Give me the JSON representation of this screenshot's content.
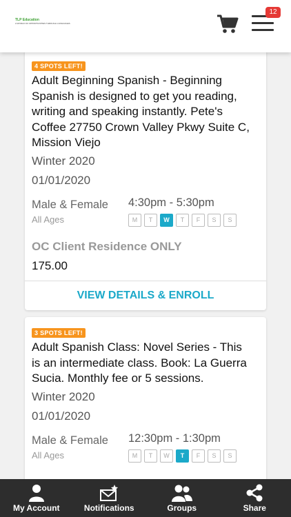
{
  "header": {
    "logo_line1": "TLP Education",
    "logo_line2": "A WORLD OF OPPORTUNITIES THROUGH LANGUAGES",
    "cart_icon": "cart-icon",
    "menu_icon": "hamburger-menu-icon",
    "notification_count": "12"
  },
  "courses": [
    {
      "spots": "4 SPOTS LEFT!",
      "title": "Adult Beginning Spanish - Beginning Spanish is designed to get you reading, writing and speaking instantly. Pete's Coffee 27750 Crown Valley Pkwy Suite C, Mission Viejo",
      "season": "Winter 2020",
      "date": "01/01/2020",
      "gender": "Male & Female",
      "ages": "All Ages",
      "time": "4:30pm - 5:30pm",
      "days": [
        "M",
        "T",
        "W",
        "T",
        "F",
        "S",
        "S"
      ],
      "active_day": 2,
      "location": "OC Client Residence ONLY",
      "price": "175.00",
      "enroll_label": "VIEW DETAILS & ENROLL"
    },
    {
      "spots": "3 SPOTS LEFT!",
      "title": "Adult Spanish Class: Novel Series - This is an intermediate class. Book: La Guerra Sucia. Monthly fee or 5 sessions.",
      "season": "Winter 2020",
      "date": "01/01/2020",
      "gender": "Male & Female",
      "ages": "All Ages",
      "time": "12:30pm - 1:30pm",
      "days": [
        "M",
        "T",
        "W",
        "T",
        "F",
        "S",
        "S"
      ],
      "active_day": 3
    }
  ],
  "tabbar": {
    "items": [
      {
        "label": "My Account",
        "icon": "user-icon"
      },
      {
        "label": "Notifications",
        "icon": "envelope-star-icon"
      },
      {
        "label": "Groups",
        "icon": "group-icon"
      },
      {
        "label": "Share",
        "icon": "share-icon"
      }
    ]
  },
  "colors": {
    "accent": "#1ba9c9",
    "spots_badge": "#f7941d",
    "notification_badge": "#e53935",
    "tabbar_bg": "#2d2d2d"
  }
}
